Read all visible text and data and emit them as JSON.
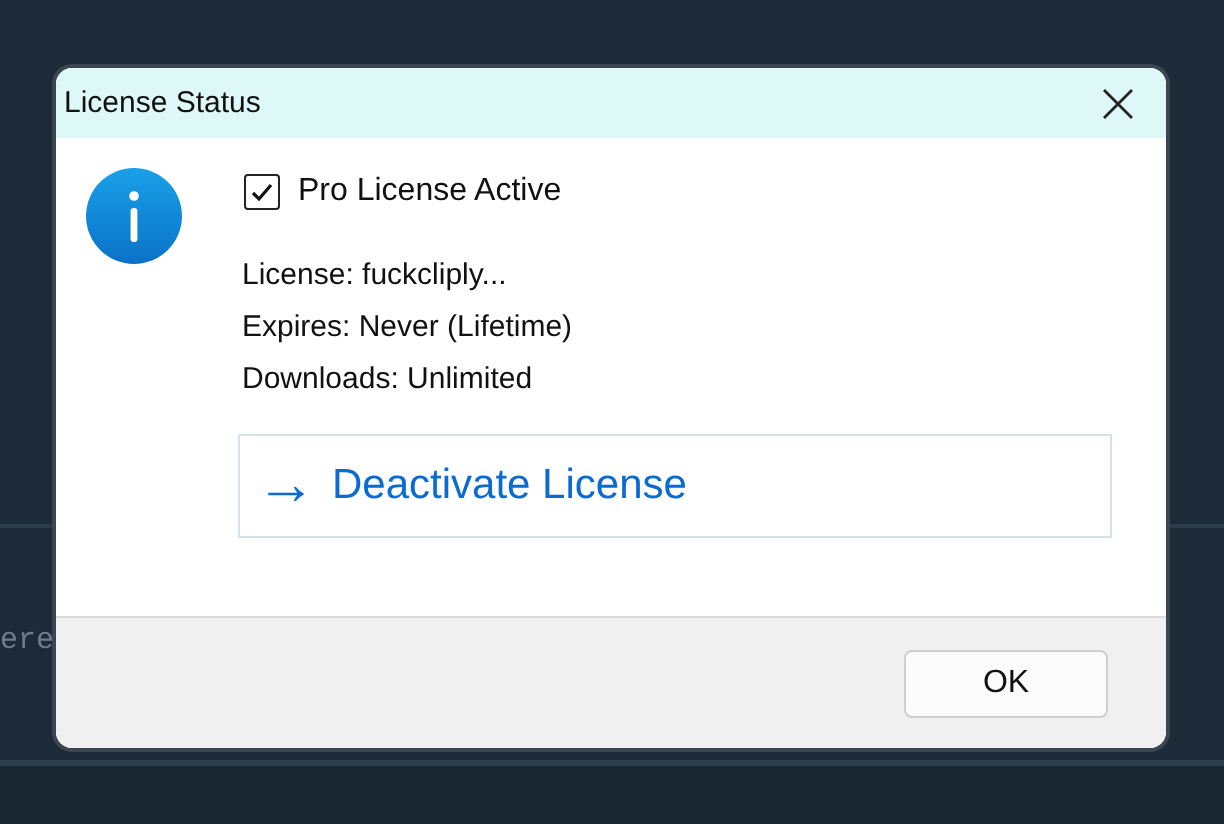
{
  "background": {
    "text": "ere"
  },
  "dialog": {
    "title": "License Status",
    "status": {
      "label": "Pro License Active",
      "checked": true
    },
    "details": [
      "License: fuckcliply...",
      "Expires: Never (Lifetime)",
      "Downloads: Unlimited"
    ],
    "link": {
      "arrow": "→",
      "label": "Deactivate License"
    },
    "buttons": [
      "OK"
    ]
  }
}
